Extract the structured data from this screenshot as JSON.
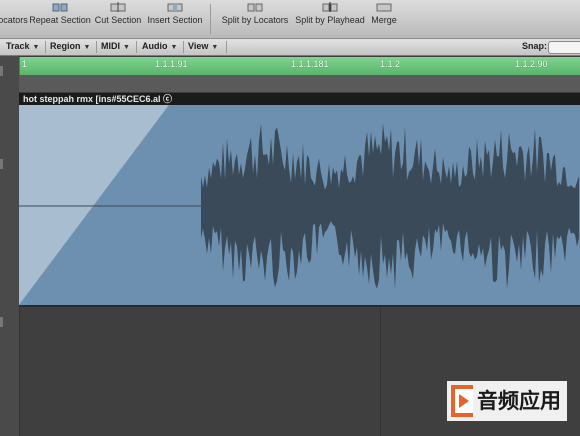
{
  "toolbar": {
    "buttons": [
      {
        "label": "ocators",
        "icon": "set-locators-icon"
      },
      {
        "label": "Repeat Section",
        "icon": "repeat-section-icon"
      },
      {
        "label": "Cut Section",
        "icon": "cut-section-icon"
      },
      {
        "label": "Insert Section",
        "icon": "insert-section-icon"
      },
      {
        "label": "Split by Locators",
        "icon": "split-by-locators-icon"
      },
      {
        "label": "Split by Playhead",
        "icon": "split-by-playhead-icon"
      },
      {
        "label": "Merge",
        "icon": "merge-icon"
      }
    ]
  },
  "menubar": {
    "items": [
      "Track",
      "Region",
      "MIDI",
      "Audio",
      "View"
    ],
    "snap_label": "Snap:",
    "snap_value": ""
  },
  "ruler": {
    "marks": [
      "1",
      "1.1.1.91",
      "1.1.1.181",
      "1.1.2",
      "1.1.2.90"
    ]
  },
  "region": {
    "title": "hot steppah rmx [ins#55CEC6.al ⓒ"
  },
  "watermark": {
    "text": "音频应用"
  },
  "colors": {
    "ruler": "#6cc47c",
    "region_body": "#6e90b0",
    "region_fade": "#a9bdd0",
    "waveform": "#3a4a59",
    "background": "#3d3d3d"
  }
}
